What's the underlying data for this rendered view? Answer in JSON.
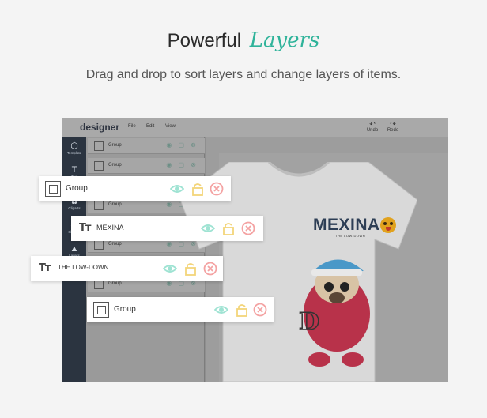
{
  "header": {
    "title_plain": "Powerful",
    "title_script": "Layers",
    "subtitle": "Drag and drop to sort layers and change layers of items."
  },
  "app": {
    "logo": "designer",
    "menu": [
      "File",
      "Edit",
      "View"
    ],
    "toolbar": {
      "undo": "Undo",
      "redo": "Redo"
    },
    "nav": [
      {
        "label": "Template",
        "icon": "cube-icon"
      },
      {
        "label": "Text",
        "icon": "text-icon"
      },
      {
        "label": "Cliparts",
        "icon": "clipart-icon"
      },
      {
        "label": "Shapes",
        "icon": "shapes-icon"
      },
      {
        "label": "Layers",
        "icon": "layers-icon"
      }
    ],
    "mini_layers": [
      "Group",
      "Group",
      "Group",
      "Group",
      "Group",
      "Group",
      "Group"
    ]
  },
  "floating_layers": [
    {
      "type": "group",
      "label": "Group"
    },
    {
      "type": "text",
      "label": "MEXINA"
    },
    {
      "type": "text",
      "label": "THE LOW-DOWN"
    },
    {
      "type": "group",
      "label": "Group"
    }
  ],
  "design": {
    "brand": "MEXINA",
    "tagline": "THE LOW-DOWN"
  },
  "colors": {
    "accent": "#2fb39a",
    "eye": "#9fe3d3",
    "lock": "#f3d57a",
    "delete": "#f4a3a3"
  }
}
